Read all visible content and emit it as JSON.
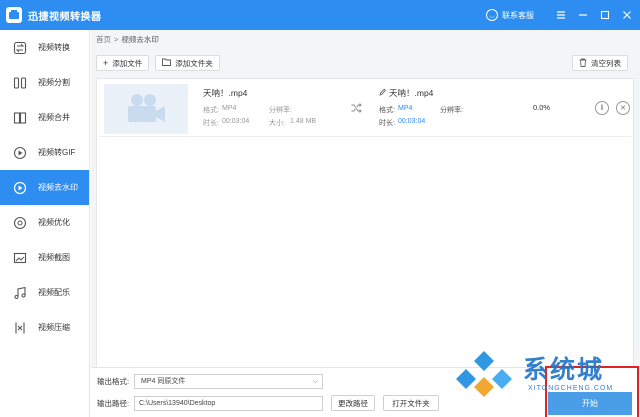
{
  "titlebar": {
    "title": "迅捷视频转换器",
    "support_label": "联系客服"
  },
  "sidebar": {
    "items": [
      {
        "label": "视频转换",
        "icon": "convert-icon",
        "active": false
      },
      {
        "label": "视频分割",
        "icon": "split-icon",
        "active": false
      },
      {
        "label": "视频合并",
        "icon": "merge-icon",
        "active": false
      },
      {
        "label": "视频转GIF",
        "icon": "gif-icon",
        "active": false
      },
      {
        "label": "视频去水印",
        "icon": "watermark-remove-icon",
        "active": true
      },
      {
        "label": "视频优化",
        "icon": "optimize-icon",
        "active": false
      },
      {
        "label": "视频截图",
        "icon": "screenshot-icon",
        "active": false
      },
      {
        "label": "视频配乐",
        "icon": "music-icon",
        "active": false
      },
      {
        "label": "视频压缩",
        "icon": "compress-icon",
        "active": false
      }
    ]
  },
  "breadcrumb": {
    "home": "首页",
    "separator": ">",
    "current": "视频去水印"
  },
  "toolbar": {
    "add_file": "添加文件",
    "add_folder": "添加文件夹",
    "clear_list": "清空列表"
  },
  "file": {
    "source": {
      "name": "天呐！.mp4",
      "format_label": "格式:",
      "format": "MP4",
      "resolution_label": "分辨率:",
      "resolution": "",
      "duration_label": "时长:",
      "duration": "00:03:04",
      "size_label": "大小:",
      "size": "1.48 MB"
    },
    "output": {
      "name": "天呐！.mp4",
      "format_label": "格式:",
      "format": "MP4",
      "resolution_label": "分辨率:",
      "resolution": "",
      "duration_label": "时长:",
      "duration": "00:03:04"
    },
    "progress": "0.0%"
  },
  "bottom": {
    "format_label": "输出格式:",
    "format_value": "MP4  同原文件",
    "path_label": "输出路径:",
    "path_value": "C:\\Users\\13940\\Desktop",
    "change_path": "更改路径",
    "open_folder": "打开文件夹",
    "start": "开始"
  },
  "watermark": {
    "text": "系统城",
    "sub": "XITONGCHENG.COM"
  },
  "colors": {
    "accent": "#2e8df0",
    "highlight_box": "#e02424"
  }
}
